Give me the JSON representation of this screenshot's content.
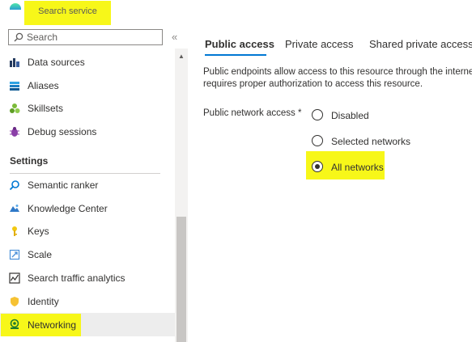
{
  "sidebar": {
    "title": "Search service",
    "search": {
      "placeholder": "Search",
      "value": ""
    },
    "collapse_glyph": "«",
    "items_top": [
      {
        "label": "Data sources",
        "icon": "data-sources-icon"
      },
      {
        "label": "Aliases",
        "icon": "aliases-icon"
      },
      {
        "label": "Skillsets",
        "icon": "skillsets-icon"
      },
      {
        "label": "Debug sessions",
        "icon": "debug-sessions-icon"
      }
    ],
    "settings_header": "Settings",
    "settings_items": [
      {
        "label": "Semantic ranker",
        "icon": "semantic-ranker-icon"
      },
      {
        "label": "Knowledge Center",
        "icon": "knowledge-center-icon"
      },
      {
        "label": "Keys",
        "icon": "key-icon"
      },
      {
        "label": "Scale",
        "icon": "scale-icon"
      },
      {
        "label": "Search traffic analytics",
        "icon": "analytics-icon"
      },
      {
        "label": "Identity",
        "icon": "identity-icon"
      },
      {
        "label": "Networking",
        "icon": "networking-icon",
        "selected": true
      }
    ]
  },
  "main": {
    "tabs": [
      {
        "label": "Public access",
        "selected": true
      },
      {
        "label": "Private access"
      },
      {
        "label": "Shared private access"
      }
    ],
    "description": {
      "line1": "Public endpoints allow access to this resource through the internet",
      "line2": "requires proper authorization to access this resource."
    },
    "public_network_access": {
      "label": "Public network access *",
      "options": [
        {
          "label": "Disabled",
          "selected": false
        },
        {
          "label": "Selected networks",
          "selected": false
        },
        {
          "label": "All networks",
          "selected": true
        }
      ]
    }
  },
  "colors": {
    "highlight": "#f7f719",
    "accent": "#0078d4",
    "text": "#323130",
    "selected_row": "#ededed"
  }
}
